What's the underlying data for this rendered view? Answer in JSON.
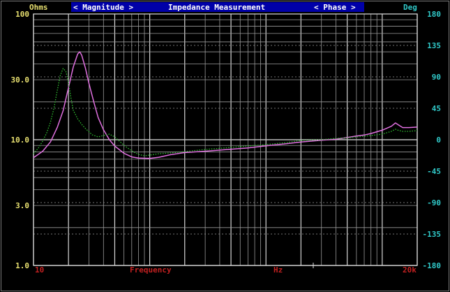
{
  "header": {
    "left_unit": "Ohms",
    "magnitude_tab": "< Magnitude >",
    "title": "Impedance Measurement",
    "phase_tab": "< Phase >",
    "right_unit": "Deg"
  },
  "footer": {
    "x_start": "10",
    "x_label": "Frequency",
    "x_unit": "Hz",
    "x_end": "20k"
  },
  "colors": {
    "background": "#000000",
    "grid": "#9a9a9a",
    "grid_bold": "#d8d8d8",
    "left_axis_text": "#e8e070",
    "right_axis_text": "#30c8c8",
    "header_bar": "#0000a8",
    "header_text": "#ffffff",
    "footer_text": "#c02020",
    "magnitude_series": "#e070e0",
    "phase_series": "#30c030"
  },
  "chart_data": {
    "type": "line",
    "title": "Impedance Measurement",
    "xlabel": "Frequency",
    "x_unit": "Hz",
    "x_scale": "log",
    "xlim": [
      10,
      20000
    ],
    "y_left": {
      "label": "Ohms",
      "scale": "log",
      "lim": [
        1,
        100
      ],
      "ticks": [
        "100",
        "30.0",
        "10.0",
        "3.0",
        "1.0"
      ]
    },
    "y_right": {
      "label": "Deg",
      "scale": "linear",
      "lim": [
        -180,
        180
      ],
      "ticks": [
        "180",
        "135",
        "90",
        "45",
        "0",
        "-45",
        "-90",
        "-135",
        "-180"
      ]
    },
    "grid": true,
    "series": [
      {
        "axis": "left",
        "style": "solid",
        "color": "#e070e0",
        "points": [
          [
            10,
            7.2
          ],
          [
            12,
            8.1
          ],
          [
            14,
            9.6
          ],
          [
            16,
            12.5
          ],
          [
            18,
            17
          ],
          [
            20,
            26
          ],
          [
            22,
            38
          ],
          [
            24,
            48
          ],
          [
            25,
            50
          ],
          [
            26,
            47
          ],
          [
            28,
            37
          ],
          [
            30,
            28
          ],
          [
            33,
            20
          ],
          [
            36,
            15
          ],
          [
            40,
            12
          ],
          [
            45,
            10
          ],
          [
            50,
            8.9
          ],
          [
            60,
            7.8
          ],
          [
            70,
            7.3
          ],
          [
            80,
            7.15
          ],
          [
            100,
            7.1
          ],
          [
            120,
            7.25
          ],
          [
            150,
            7.6
          ],
          [
            200,
            7.9
          ],
          [
            300,
            8.1
          ],
          [
            500,
            8.4
          ],
          [
            700,
            8.6
          ],
          [
            1000,
            8.95
          ],
          [
            1500,
            9.3
          ],
          [
            2000,
            9.6
          ],
          [
            3000,
            9.9
          ],
          [
            4000,
            10.1
          ],
          [
            5000,
            10.4
          ],
          [
            6000,
            10.7
          ],
          [
            7000,
            10.9
          ],
          [
            8000,
            11.2
          ],
          [
            10000,
            11.9
          ],
          [
            12000,
            12.8
          ],
          [
            13000,
            13.6
          ],
          [
            14000,
            13.0
          ],
          [
            15000,
            12.5
          ],
          [
            17000,
            12.5
          ],
          [
            20000,
            12.6
          ]
        ]
      },
      {
        "axis": "right",
        "style": "dotted",
        "color": "#30c030",
        "points": [
          [
            10,
            -20
          ],
          [
            11,
            -12
          ],
          [
            12,
            -2
          ],
          [
            13,
            10
          ],
          [
            14,
            25
          ],
          [
            15,
            45
          ],
          [
            16,
            70
          ],
          [
            17,
            92
          ],
          [
            18,
            102
          ],
          [
            19,
            98
          ],
          [
            20,
            82
          ],
          [
            21,
            60
          ],
          [
            22,
            42
          ],
          [
            24,
            30
          ],
          [
            26,
            22
          ],
          [
            28,
            16
          ],
          [
            32,
            7
          ],
          [
            36,
            4
          ],
          [
            40,
            6
          ],
          [
            45,
            8
          ],
          [
            50,
            4
          ],
          [
            60,
            -8
          ],
          [
            70,
            -16
          ],
          [
            80,
            -21
          ],
          [
            90,
            -23
          ],
          [
            100,
            -22
          ],
          [
            120,
            -20
          ],
          [
            150,
            -19
          ],
          [
            200,
            -17
          ],
          [
            300,
            -14
          ],
          [
            500,
            -11
          ],
          [
            1000,
            -7
          ],
          [
            1500,
            -4
          ],
          [
            2000,
            -1
          ],
          [
            3000,
            0
          ],
          [
            4000,
            2
          ],
          [
            5000,
            2.5
          ],
          [
            6000,
            4
          ],
          [
            7000,
            5
          ],
          [
            8000,
            6
          ],
          [
            10000,
            8
          ],
          [
            12000,
            12
          ],
          [
            13000,
            15
          ],
          [
            14000,
            13
          ],
          [
            15000,
            12
          ],
          [
            17000,
            12
          ],
          [
            20000,
            13
          ]
        ]
      }
    ]
  }
}
